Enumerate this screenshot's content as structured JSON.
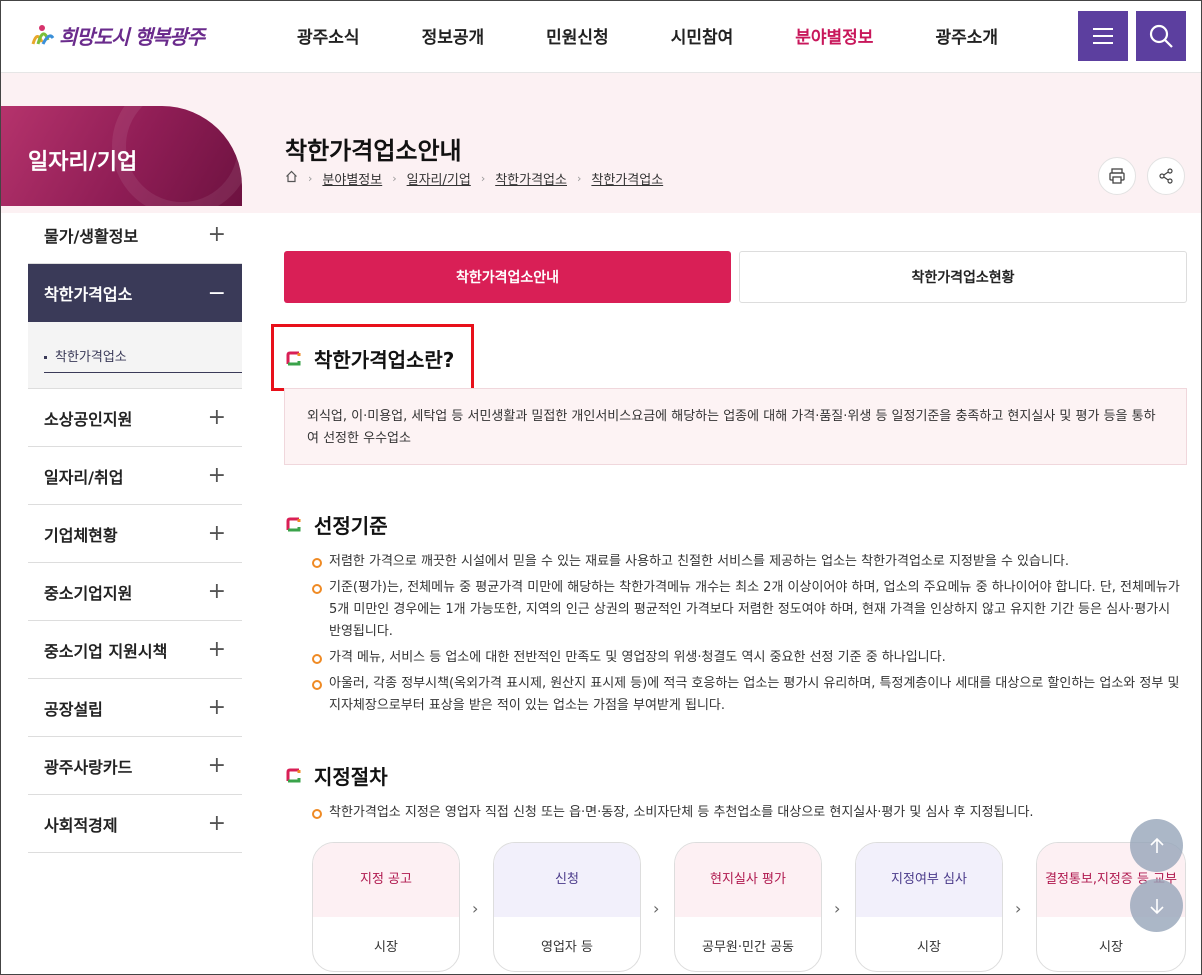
{
  "header": {
    "logo_text": "희망도시 행복광주",
    "nav": [
      "광주소식",
      "정보공개",
      "민원신청",
      "시민참여",
      "분야별정보",
      "광주소개"
    ],
    "active_nav": "분야별정보",
    "menu_icon": "hamburger-icon",
    "search_icon": "search-icon"
  },
  "sidebar": {
    "title": "일자리/기업",
    "items": [
      {
        "label": "물가/생활정보",
        "toggle": "+"
      },
      {
        "label": "착한가격업소",
        "toggle": "−"
      },
      {
        "label": "소상공인지원",
        "toggle": "+"
      },
      {
        "label": "일자리/취업",
        "toggle": "+"
      },
      {
        "label": "기업체현황",
        "toggle": "+"
      },
      {
        "label": "중소기업지원",
        "toggle": "+"
      },
      {
        "label": "중소기업 지원시책",
        "toggle": "+"
      },
      {
        "label": "공장설립",
        "toggle": "+"
      },
      {
        "label": "광주사랑카드",
        "toggle": "+"
      },
      {
        "label": "사회적경제",
        "toggle": "+"
      }
    ],
    "sub_items": [
      "착한가격업소"
    ]
  },
  "page": {
    "title": "착한가격업소안내",
    "breadcrumb": [
      "분야별정보",
      "일자리/기업",
      "착한가격업소",
      "착한가격업소"
    ]
  },
  "tabs": [
    "착한가격업소안내",
    "착한가격업소현황"
  ],
  "sections": {
    "definition": {
      "heading": "착한가격업소란?",
      "text": "외식업, 이·미용업, 세탁업 등 서민생활과 밀접한 개인서비스요금에 해당하는 업종에 대해 가격·품질·위생 등 일정기준을 충족하고 현지실사 및 평가 등을 통하여 선정한 우수업소"
    },
    "criteria": {
      "heading": "선정기준",
      "bullets": [
        "저렴한 가격으로 깨끗한 시설에서 믿을 수 있는 재료를 사용하고 친절한 서비스를 제공하는 업소는 착한가격업소로 지정받을 수 있습니다.",
        "기준(평가)는, 전체메뉴 중 평균가격 미만에 해당하는 착한가격메뉴 개수는 최소 2개 이상이어야 하며, 업소의 주요메뉴 중 하나이어야 합니다. 단, 전체메뉴가 5개 미만인 경우에는 1개 가능또한, 지역의 인근 상권의 평균적인 가격보다 저렴한 정도여야 하며, 현재 가격을 인상하지 않고 유지한 기간 등은 심사·평가시 반영됩니다.",
        "가격 메뉴, 서비스 등 업소에 대한 전반적인 만족도 및 영업장의 위생·청결도 역시 중요한 선정 기준 중 하나입니다.",
        "아울러, 각종 정부시책(옥외가격 표시제, 원산지 표시제 등)에 적극 호응하는 업소는 평가시 유리하며, 특정계층이나 세대를 대상으로 할인하는 업소와 정부 및 지자체장으로부터 표상을 받은 적이 있는 업소는 가점을 부여받게 됩니다."
      ]
    },
    "procedure": {
      "heading": "지정절차",
      "bullets": [
        "착한가격업소 지정은 영업자 직접 신청 또는 읍·면·동장, 소비자단체 등 추천업소를 대상으로 현지실사·평가 및 심사 후 지정됩니다."
      ],
      "steps": [
        {
          "title": "지정 공고",
          "actor": "시장",
          "tone": "pink"
        },
        {
          "title": "신청",
          "actor": "영업자 등",
          "tone": "purple"
        },
        {
          "title": "현지실사 평가",
          "actor": "공무원·민간 공동",
          "tone": "pink"
        },
        {
          "title": "지정여부 심사",
          "actor": "시장",
          "tone": "purple"
        },
        {
          "title": "결정통보,지정증 등 교부",
          "actor": "시장",
          "tone": "pink"
        }
      ],
      "step_arrow": "›"
    }
  },
  "float_buttons": {
    "up": "↑",
    "down": "↓"
  },
  "colors": {
    "accent": "#d91f56",
    "nav_active": "#c8175b",
    "header_btn": "#5c3f9f",
    "sidebar_active": "#3a3a58",
    "bullet": "#ef8a24",
    "highlight_box": "#e8101a"
  }
}
